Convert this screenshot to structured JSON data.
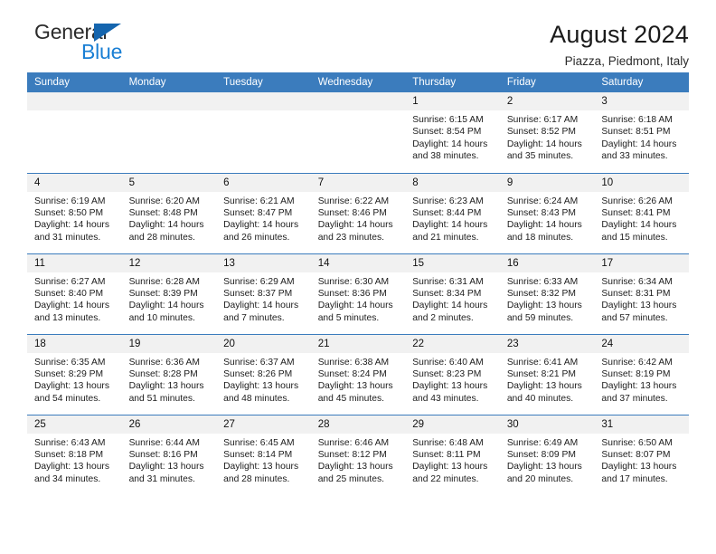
{
  "logo": {
    "word1": "General",
    "word2": "Blue",
    "triangle_color": "#1565ae",
    "blue_color": "#1a7fd4"
  },
  "header": {
    "title": "August 2024",
    "subtitle": "Piazza, Piedmont, Italy",
    "header_bg": "#3b7cbd"
  },
  "calendar": {
    "weekday_headers": [
      "Sunday",
      "Monday",
      "Tuesday",
      "Wednesday",
      "Thursday",
      "Friday",
      "Saturday"
    ],
    "weeks": [
      [
        {
          "day": "",
          "sunrise": "",
          "sunset": "",
          "daylight1": "",
          "daylight2": "",
          "empty": true
        },
        {
          "day": "",
          "sunrise": "",
          "sunset": "",
          "daylight1": "",
          "daylight2": "",
          "empty": true
        },
        {
          "day": "",
          "sunrise": "",
          "sunset": "",
          "daylight1": "",
          "daylight2": "",
          "empty": true
        },
        {
          "day": "",
          "sunrise": "",
          "sunset": "",
          "daylight1": "",
          "daylight2": "",
          "empty": true
        },
        {
          "day": "1",
          "sunrise": "Sunrise: 6:15 AM",
          "sunset": "Sunset: 8:54 PM",
          "daylight1": "Daylight: 14 hours",
          "daylight2": "and 38 minutes."
        },
        {
          "day": "2",
          "sunrise": "Sunrise: 6:17 AM",
          "sunset": "Sunset: 8:52 PM",
          "daylight1": "Daylight: 14 hours",
          "daylight2": "and 35 minutes."
        },
        {
          "day": "3",
          "sunrise": "Sunrise: 6:18 AM",
          "sunset": "Sunset: 8:51 PM",
          "daylight1": "Daylight: 14 hours",
          "daylight2": "and 33 minutes."
        }
      ],
      [
        {
          "day": "4",
          "sunrise": "Sunrise: 6:19 AM",
          "sunset": "Sunset: 8:50 PM",
          "daylight1": "Daylight: 14 hours",
          "daylight2": "and 31 minutes."
        },
        {
          "day": "5",
          "sunrise": "Sunrise: 6:20 AM",
          "sunset": "Sunset: 8:48 PM",
          "daylight1": "Daylight: 14 hours",
          "daylight2": "and 28 minutes."
        },
        {
          "day": "6",
          "sunrise": "Sunrise: 6:21 AM",
          "sunset": "Sunset: 8:47 PM",
          "daylight1": "Daylight: 14 hours",
          "daylight2": "and 26 minutes."
        },
        {
          "day": "7",
          "sunrise": "Sunrise: 6:22 AM",
          "sunset": "Sunset: 8:46 PM",
          "daylight1": "Daylight: 14 hours",
          "daylight2": "and 23 minutes."
        },
        {
          "day": "8",
          "sunrise": "Sunrise: 6:23 AM",
          "sunset": "Sunset: 8:44 PM",
          "daylight1": "Daylight: 14 hours",
          "daylight2": "and 21 minutes."
        },
        {
          "day": "9",
          "sunrise": "Sunrise: 6:24 AM",
          "sunset": "Sunset: 8:43 PM",
          "daylight1": "Daylight: 14 hours",
          "daylight2": "and 18 minutes."
        },
        {
          "day": "10",
          "sunrise": "Sunrise: 6:26 AM",
          "sunset": "Sunset: 8:41 PM",
          "daylight1": "Daylight: 14 hours",
          "daylight2": "and 15 minutes."
        }
      ],
      [
        {
          "day": "11",
          "sunrise": "Sunrise: 6:27 AM",
          "sunset": "Sunset: 8:40 PM",
          "daylight1": "Daylight: 14 hours",
          "daylight2": "and 13 minutes."
        },
        {
          "day": "12",
          "sunrise": "Sunrise: 6:28 AM",
          "sunset": "Sunset: 8:39 PM",
          "daylight1": "Daylight: 14 hours",
          "daylight2": "and 10 minutes."
        },
        {
          "day": "13",
          "sunrise": "Sunrise: 6:29 AM",
          "sunset": "Sunset: 8:37 PM",
          "daylight1": "Daylight: 14 hours",
          "daylight2": "and 7 minutes."
        },
        {
          "day": "14",
          "sunrise": "Sunrise: 6:30 AM",
          "sunset": "Sunset: 8:36 PM",
          "daylight1": "Daylight: 14 hours",
          "daylight2": "and 5 minutes."
        },
        {
          "day": "15",
          "sunrise": "Sunrise: 6:31 AM",
          "sunset": "Sunset: 8:34 PM",
          "daylight1": "Daylight: 14 hours",
          "daylight2": "and 2 minutes."
        },
        {
          "day": "16",
          "sunrise": "Sunrise: 6:33 AM",
          "sunset": "Sunset: 8:32 PM",
          "daylight1": "Daylight: 13 hours",
          "daylight2": "and 59 minutes."
        },
        {
          "day": "17",
          "sunrise": "Sunrise: 6:34 AM",
          "sunset": "Sunset: 8:31 PM",
          "daylight1": "Daylight: 13 hours",
          "daylight2": "and 57 minutes."
        }
      ],
      [
        {
          "day": "18",
          "sunrise": "Sunrise: 6:35 AM",
          "sunset": "Sunset: 8:29 PM",
          "daylight1": "Daylight: 13 hours",
          "daylight2": "and 54 minutes."
        },
        {
          "day": "19",
          "sunrise": "Sunrise: 6:36 AM",
          "sunset": "Sunset: 8:28 PM",
          "daylight1": "Daylight: 13 hours",
          "daylight2": "and 51 minutes."
        },
        {
          "day": "20",
          "sunrise": "Sunrise: 6:37 AM",
          "sunset": "Sunset: 8:26 PM",
          "daylight1": "Daylight: 13 hours",
          "daylight2": "and 48 minutes."
        },
        {
          "day": "21",
          "sunrise": "Sunrise: 6:38 AM",
          "sunset": "Sunset: 8:24 PM",
          "daylight1": "Daylight: 13 hours",
          "daylight2": "and 45 minutes."
        },
        {
          "day": "22",
          "sunrise": "Sunrise: 6:40 AM",
          "sunset": "Sunset: 8:23 PM",
          "daylight1": "Daylight: 13 hours",
          "daylight2": "and 43 minutes."
        },
        {
          "day": "23",
          "sunrise": "Sunrise: 6:41 AM",
          "sunset": "Sunset: 8:21 PM",
          "daylight1": "Daylight: 13 hours",
          "daylight2": "and 40 minutes."
        },
        {
          "day": "24",
          "sunrise": "Sunrise: 6:42 AM",
          "sunset": "Sunset: 8:19 PM",
          "daylight1": "Daylight: 13 hours",
          "daylight2": "and 37 minutes."
        }
      ],
      [
        {
          "day": "25",
          "sunrise": "Sunrise: 6:43 AM",
          "sunset": "Sunset: 8:18 PM",
          "daylight1": "Daylight: 13 hours",
          "daylight2": "and 34 minutes."
        },
        {
          "day": "26",
          "sunrise": "Sunrise: 6:44 AM",
          "sunset": "Sunset: 8:16 PM",
          "daylight1": "Daylight: 13 hours",
          "daylight2": "and 31 minutes."
        },
        {
          "day": "27",
          "sunrise": "Sunrise: 6:45 AM",
          "sunset": "Sunset: 8:14 PM",
          "daylight1": "Daylight: 13 hours",
          "daylight2": "and 28 minutes."
        },
        {
          "day": "28",
          "sunrise": "Sunrise: 6:46 AM",
          "sunset": "Sunset: 8:12 PM",
          "daylight1": "Daylight: 13 hours",
          "daylight2": "and 25 minutes."
        },
        {
          "day": "29",
          "sunrise": "Sunrise: 6:48 AM",
          "sunset": "Sunset: 8:11 PM",
          "daylight1": "Daylight: 13 hours",
          "daylight2": "and 22 minutes."
        },
        {
          "day": "30",
          "sunrise": "Sunrise: 6:49 AM",
          "sunset": "Sunset: 8:09 PM",
          "daylight1": "Daylight: 13 hours",
          "daylight2": "and 20 minutes."
        },
        {
          "day": "31",
          "sunrise": "Sunrise: 6:50 AM",
          "sunset": "Sunset: 8:07 PM",
          "daylight1": "Daylight: 13 hours",
          "daylight2": "and 17 minutes."
        }
      ]
    ]
  }
}
